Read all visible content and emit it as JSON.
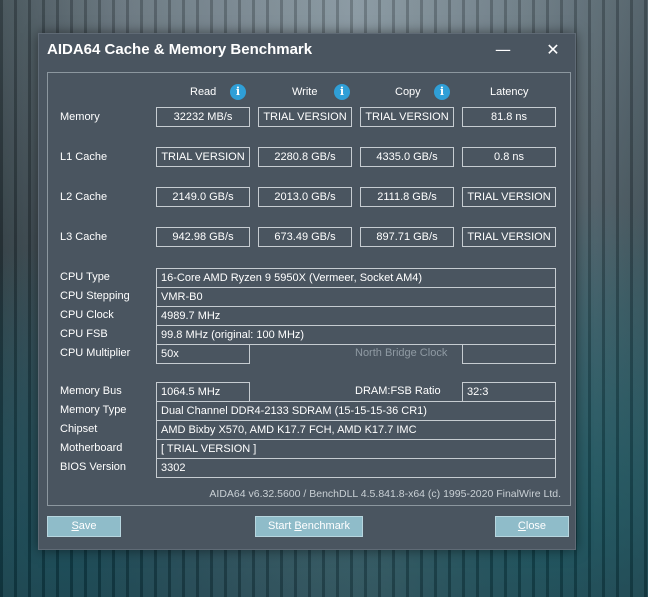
{
  "window": {
    "title": "AIDA64 Cache & Memory Benchmark",
    "minimize_glyph": "—",
    "close_glyph": "✕"
  },
  "columns": {
    "read": "Read",
    "write": "Write",
    "copy": "Copy",
    "latency": "Latency"
  },
  "rows": [
    {
      "label": "Memory",
      "read": "32232 MB/s",
      "write": "TRIAL VERSION",
      "copy": "TRIAL VERSION",
      "latency": "81.8 ns"
    },
    {
      "label": "L1 Cache",
      "read": "TRIAL VERSION",
      "write": "2280.8 GB/s",
      "copy": "4335.0 GB/s",
      "latency": "0.8 ns"
    },
    {
      "label": "L2 Cache",
      "read": "2149.0 GB/s",
      "write": "2013.0 GB/s",
      "copy": "2111.8 GB/s",
      "latency": "TRIAL VERSION"
    },
    {
      "label": "L3 Cache",
      "read": "942.98 GB/s",
      "write": "673.49 GB/s",
      "copy": "897.71 GB/s",
      "latency": "TRIAL VERSION"
    }
  ],
  "cpu": {
    "type_label": "CPU Type",
    "type_value": "16-Core AMD Ryzen 9 5950X  (Vermeer, Socket AM4)",
    "stepping_label": "CPU Stepping",
    "stepping_value": "VMR-B0",
    "clock_label": "CPU Clock",
    "clock_value": "4989.7 MHz",
    "fsb_label": "CPU FSB",
    "fsb_value": "99.8 MHz  (original: 100 MHz)",
    "multiplier_label": "CPU Multiplier",
    "multiplier_value": "50x",
    "nb_clock_label": "North Bridge Clock",
    "nb_clock_value": ""
  },
  "memory": {
    "bus_label": "Memory Bus",
    "bus_value": "1064.5 MHz",
    "ratio_label": "DRAM:FSB Ratio",
    "ratio_value": "32:3",
    "type_label": "Memory Type",
    "type_value": "Dual Channel DDR4-2133 SDRAM  (15-15-15-36 CR1)",
    "chipset_label": "Chipset",
    "chipset_value": "AMD Bixby X570, AMD K17.7 FCH, AMD K17.7 IMC",
    "motherboard_label": "Motherboard",
    "motherboard_value": "[ TRIAL VERSION ]",
    "bios_label": "BIOS Version",
    "bios_value": "3302"
  },
  "footer": "AIDA64 v6.32.5600 / BenchDLL 4.5.841.8-x64  (c) 1995-2020 FinalWire Ltd.",
  "buttons": {
    "save_first": "S",
    "save_rest": "ave",
    "start_first": "Start ",
    "start_accel": "B",
    "start_rest": "enchmark",
    "close_first": "C",
    "close_rest": "lose"
  }
}
